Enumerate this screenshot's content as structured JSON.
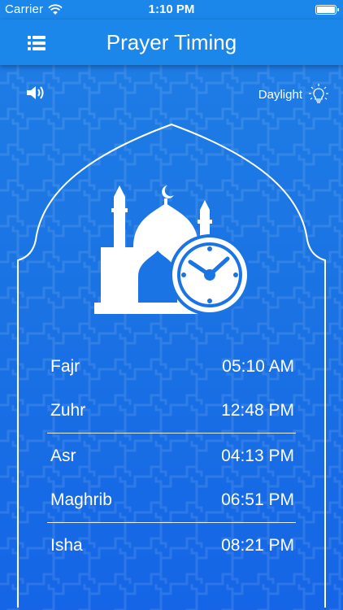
{
  "status_bar": {
    "carrier": "Carrier",
    "time": "1:10 PM"
  },
  "header": {
    "title": "Prayer Timing",
    "menu_icon": "hamburger-list-icon"
  },
  "controls": {
    "sound_icon": "speaker-icon",
    "daylight_label": "Daylight",
    "daylight_icon": "lightbulb-icon"
  },
  "illustration": {
    "icon": "mosque-clock-icon"
  },
  "prayers": [
    {
      "name": "Fajr",
      "time": "05:10 AM"
    },
    {
      "name": "Zuhr",
      "time": "12:48 PM"
    },
    {
      "name": "Asr",
      "time": "04:13 PM"
    },
    {
      "name": "Maghrib",
      "time": "06:51 PM"
    },
    {
      "name": "Isha",
      "time": "08:21 PM"
    }
  ],
  "colors": {
    "header": "#1c87ea",
    "background": "#1a72e3",
    "text": "#ffffff"
  }
}
